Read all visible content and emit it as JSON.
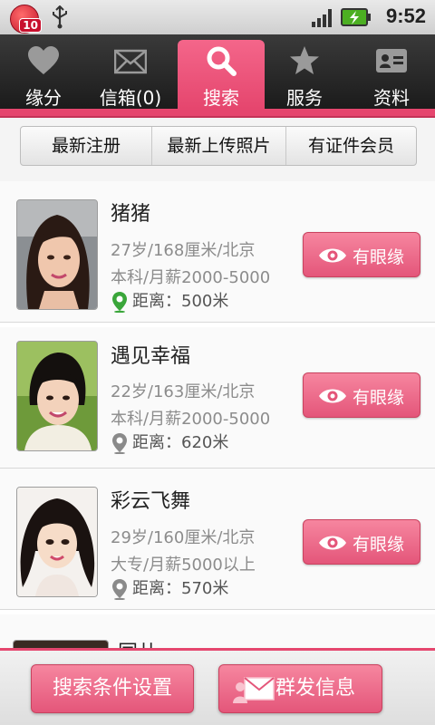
{
  "status_bar": {
    "notification_badge": "10",
    "time": "9:52",
    "icons": [
      "app-notification-icon",
      "usb-icon",
      "signal-icon",
      "battery-charging-icon"
    ]
  },
  "nav_tabs": [
    {
      "label": "缘分",
      "icon": "heart-icon",
      "active": false
    },
    {
      "label": "信箱(0)",
      "icon": "mail-icon",
      "active": false
    },
    {
      "label": "搜索",
      "icon": "search-icon",
      "active": true
    },
    {
      "label": "服务",
      "icon": "star-icon",
      "active": false
    },
    {
      "label": "资料",
      "icon": "profile-card-icon",
      "active": false
    }
  ],
  "segments": [
    "最新注册",
    "最新上传照片",
    "有证件会员"
  ],
  "users": [
    {
      "name": "猪猪",
      "line1": "27岁/168厘米/北京",
      "line2": "本科/月薪2000-5000",
      "distance": "距离：500米",
      "pin_color": "#3aa63a",
      "button": "有眼缘"
    },
    {
      "name": "遇见幸福",
      "line1": "22岁/163厘米/北京",
      "line2": "本科/月薪2000-5000",
      "distance": "距离：620米",
      "pin_color": "#8a8a8a",
      "button": "有眼缘"
    },
    {
      "name": "彩云飞舞",
      "line1": "29岁/160厘米/北京",
      "line2": "大专/月薪5000以上",
      "distance": "距离：570米",
      "pin_color": "#8a8a8a",
      "button": "有眼缘"
    },
    {
      "name": "同儿"
    }
  ],
  "bottom_bar": {
    "search_settings": "搜索条件设置",
    "broadcast_message": "群发信息"
  },
  "colors": {
    "accent": "#e5466e",
    "nav_bg": "#1b1b1b"
  }
}
